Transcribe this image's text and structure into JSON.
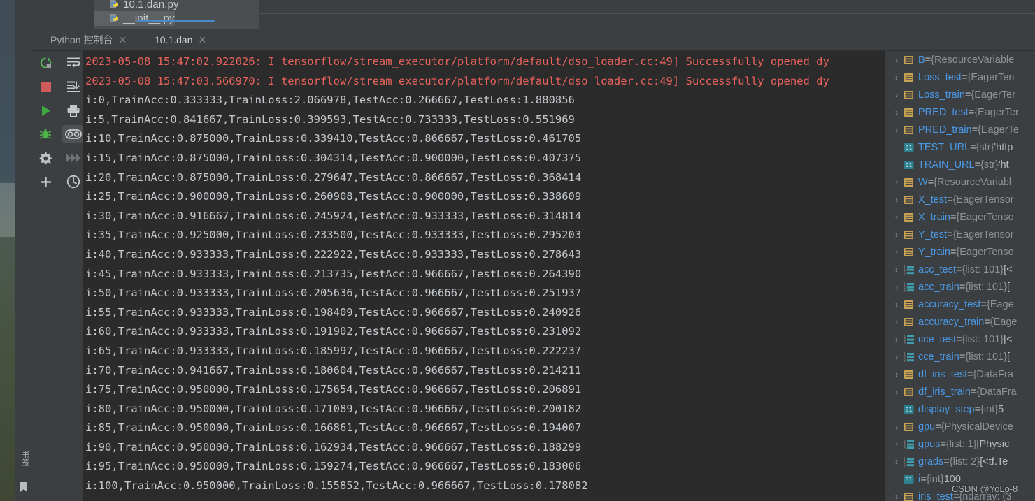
{
  "window": {
    "bookmarks_label": "书签"
  },
  "file_tree": {
    "items": [
      {
        "name": "10.1.dan.py",
        "icon": "python-file-icon"
      },
      {
        "name": "__init__.py",
        "icon": "python-file-icon"
      }
    ]
  },
  "tabs": [
    {
      "label": "Python 控制台",
      "close": "✕",
      "active": false
    },
    {
      "label": "10.1.dan",
      "close": "✕",
      "active": true
    }
  ],
  "toolbar_left": [
    {
      "name": "rerun-icon",
      "title": "Rerun"
    },
    {
      "name": "stop-icon",
      "title": "Stop"
    },
    {
      "name": "resume-icon",
      "title": "Resume Program"
    },
    {
      "name": "debug-icon",
      "title": "Debug"
    },
    {
      "name": "settings-icon",
      "title": "Settings"
    },
    {
      "name": "add-icon",
      "title": "Add"
    }
  ],
  "toolbar_right": [
    {
      "name": "soft-wrap-icon",
      "title": "Soft-Wrap"
    },
    {
      "name": "scroll-to-end-icon",
      "title": "Scroll to End"
    },
    {
      "name": "print-icon",
      "title": "Print"
    },
    {
      "name": "eye-icon",
      "title": "Show Console",
      "active": true
    },
    {
      "name": "forward-icon",
      "title": "Step Over",
      "disabled": true
    },
    {
      "name": "history-icon",
      "title": "History"
    }
  ],
  "console": {
    "lines": [
      {
        "text": "2023-05-08 15:47:02.922026: I tensorflow/stream_executor/platform/default/dso_loader.cc:49] Successfully opened dy",
        "level": "error"
      },
      {
        "text": "2023-05-08 15:47:03.566970: I tensorflow/stream_executor/platform/default/dso_loader.cc:49] Successfully opened dy",
        "level": "error"
      },
      {
        "text": "i:0,TrainAcc:0.333333,TrainLoss:2.066978,TestAcc:0.266667,TestLoss:1.880856",
        "level": "info"
      },
      {
        "text": "i:5,TrainAcc:0.841667,TrainLoss:0.399593,TestAcc:0.733333,TestLoss:0.551969",
        "level": "info"
      },
      {
        "text": "i:10,TrainAcc:0.875000,TrainLoss:0.339410,TestAcc:0.866667,TestLoss:0.461705",
        "level": "info"
      },
      {
        "text": "i:15,TrainAcc:0.875000,TrainLoss:0.304314,TestAcc:0.900000,TestLoss:0.407375",
        "level": "info"
      },
      {
        "text": "i:20,TrainAcc:0.875000,TrainLoss:0.279647,TestAcc:0.866667,TestLoss:0.368414",
        "level": "info"
      },
      {
        "text": "i:25,TrainAcc:0.900000,TrainLoss:0.260908,TestAcc:0.900000,TestLoss:0.338609",
        "level": "info"
      },
      {
        "text": "i:30,TrainAcc:0.916667,TrainLoss:0.245924,TestAcc:0.933333,TestLoss:0.314814",
        "level": "info"
      },
      {
        "text": "i:35,TrainAcc:0.925000,TrainLoss:0.233500,TestAcc:0.933333,TestLoss:0.295203",
        "level": "info"
      },
      {
        "text": "i:40,TrainAcc:0.933333,TrainLoss:0.222922,TestAcc:0.933333,TestLoss:0.278643",
        "level": "info"
      },
      {
        "text": "i:45,TrainAcc:0.933333,TrainLoss:0.213735,TestAcc:0.966667,TestLoss:0.264390",
        "level": "info"
      },
      {
        "text": "i:50,TrainAcc:0.933333,TrainLoss:0.205636,TestAcc:0.966667,TestLoss:0.251937",
        "level": "info"
      },
      {
        "text": "i:55,TrainAcc:0.933333,TrainLoss:0.198409,TestAcc:0.966667,TestLoss:0.240926",
        "level": "info"
      },
      {
        "text": "i:60,TrainAcc:0.933333,TrainLoss:0.191902,TestAcc:0.966667,TestLoss:0.231092",
        "level": "info"
      },
      {
        "text": "i:65,TrainAcc:0.933333,TrainLoss:0.185997,TestAcc:0.966667,TestLoss:0.222237",
        "level": "info"
      },
      {
        "text": "i:70,TrainAcc:0.941667,TrainLoss:0.180604,TestAcc:0.966667,TestLoss:0.214211",
        "level": "info"
      },
      {
        "text": "i:75,TrainAcc:0.950000,TrainLoss:0.175654,TestAcc:0.966667,TestLoss:0.206891",
        "level": "info"
      },
      {
        "text": "i:80,TrainAcc:0.950000,TrainLoss:0.171089,TestAcc:0.966667,TestLoss:0.200182",
        "level": "info"
      },
      {
        "text": "i:85,TrainAcc:0.950000,TrainLoss:0.166861,TestAcc:0.966667,TestLoss:0.194007",
        "level": "info"
      },
      {
        "text": "i:90,TrainAcc:0.950000,TrainLoss:0.162934,TestAcc:0.966667,TestLoss:0.188299",
        "level": "info"
      },
      {
        "text": "i:95,TrainAcc:0.950000,TrainLoss:0.159274,TestAcc:0.966667,TestLoss:0.183006",
        "level": "info"
      },
      {
        "text": "i:100,TrainAcc:0.950000,TrainLoss:0.155852,TestAcc:0.966667,TestLoss:0.178082",
        "level": "info"
      }
    ]
  },
  "variables": [
    {
      "expand": "›",
      "icon": "object-icon",
      "name": "B",
      "type": "{ResourceVariable",
      "value": ""
    },
    {
      "expand": "›",
      "icon": "object-icon",
      "name": "Loss_test",
      "type": "{EagerTen",
      "value": ""
    },
    {
      "expand": "›",
      "icon": "object-icon",
      "name": "Loss_train",
      "type": "{EagerTer",
      "value": ""
    },
    {
      "expand": "›",
      "icon": "object-icon",
      "name": "PRED_test",
      "type": "{EagerTer",
      "value": ""
    },
    {
      "expand": "›",
      "icon": "object-icon",
      "name": "PRED_train",
      "type": "{EagerTe",
      "value": ""
    },
    {
      "expand": "",
      "icon": "primitive-icon",
      "name": "TEST_URL",
      "type": "{str}",
      "value": "'http"
    },
    {
      "expand": "",
      "icon": "primitive-icon",
      "name": "TRAIN_URL",
      "type": "{str}",
      "value": "'ht"
    },
    {
      "expand": "›",
      "icon": "object-icon",
      "name": "W",
      "type": "{ResourceVariabl",
      "value": ""
    },
    {
      "expand": "›",
      "icon": "object-icon",
      "name": "X_test",
      "type": "{EagerTensor",
      "value": ""
    },
    {
      "expand": "›",
      "icon": "object-icon",
      "name": "X_train",
      "type": "{EagerTenso",
      "value": ""
    },
    {
      "expand": "›",
      "icon": "object-icon",
      "name": "Y_test",
      "type": "{EagerTensor",
      "value": ""
    },
    {
      "expand": "›",
      "icon": "object-icon",
      "name": "Y_train",
      "type": "{EagerTenso",
      "value": ""
    },
    {
      "expand": "›",
      "icon": "list-icon",
      "name": "acc_test",
      "type": "{list: 101}",
      "value": "[<"
    },
    {
      "expand": "›",
      "icon": "list-icon",
      "name": "acc_train",
      "type": "{list: 101}",
      "value": "["
    },
    {
      "expand": "›",
      "icon": "object-icon",
      "name": "accuracy_test",
      "type": "{Eage",
      "value": ""
    },
    {
      "expand": "›",
      "icon": "object-icon",
      "name": "accuracy_train",
      "type": "{Eage",
      "value": ""
    },
    {
      "expand": "›",
      "icon": "list-icon",
      "name": "cce_test",
      "type": "{list: 101}",
      "value": "[<"
    },
    {
      "expand": "›",
      "icon": "list-icon",
      "name": "cce_train",
      "type": "{list: 101}",
      "value": "["
    },
    {
      "expand": "›",
      "icon": "object-icon",
      "name": "df_iris_test",
      "type": "{DataFra",
      "value": ""
    },
    {
      "expand": "›",
      "icon": "object-icon",
      "name": "df_iris_train",
      "type": "{DataFra",
      "value": ""
    },
    {
      "expand": "",
      "icon": "primitive-icon",
      "name": "display_step",
      "type": "{int}",
      "value": "5"
    },
    {
      "expand": "›",
      "icon": "object-icon",
      "name": "gpu",
      "type": "{PhysicalDevice",
      "value": ""
    },
    {
      "expand": "›",
      "icon": "list-icon",
      "name": "gpus",
      "type": "{list: 1}",
      "value": "[Physic"
    },
    {
      "expand": "›",
      "icon": "list-icon",
      "name": "grads",
      "type": "{list: 2}",
      "value": "[<tf.Te"
    },
    {
      "expand": "",
      "icon": "primitive-icon",
      "name": "i",
      "type": "{int}",
      "value": "100"
    },
    {
      "expand": "›",
      "icon": "object-icon",
      "name": "iris_test",
      "type": "{ndarray: (3",
      "value": ""
    }
  ],
  "watermark": "CSDN @YoLo-8",
  "colors": {
    "console_bg": "#2b2b2b",
    "panel_bg": "#3c3f41",
    "error_text": "#e8625c",
    "info_text": "#c4c8cc",
    "var_name": "#4a9ae8",
    "var_type": "#8d9296",
    "tab_accent": "#4a88c7",
    "run_green": "#54b45a",
    "stop_red": "#d05b5b"
  }
}
